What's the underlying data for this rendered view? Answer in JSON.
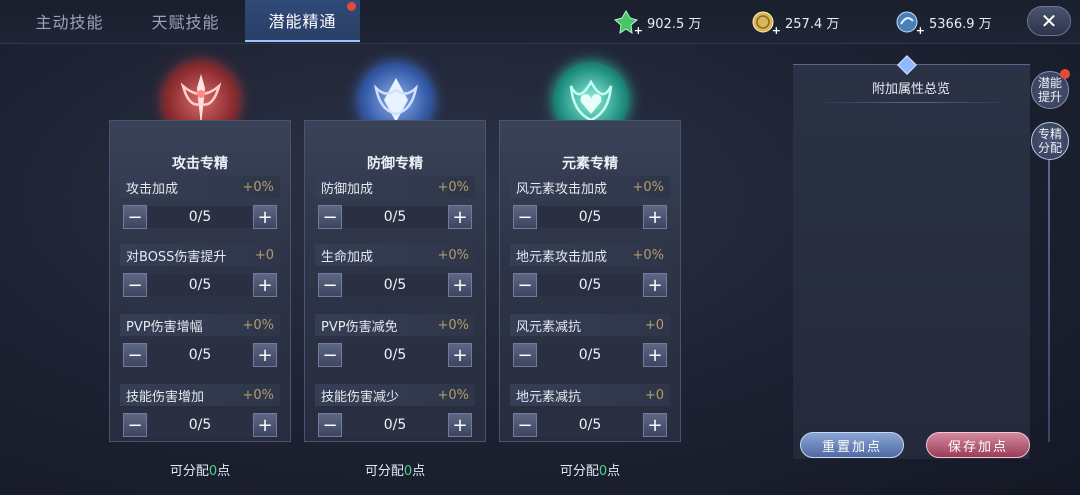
{
  "tabs": [
    {
      "label": "主动技能"
    },
    {
      "label": "天赋技能"
    },
    {
      "label": "潜能精通"
    }
  ],
  "currencies": [
    {
      "icon": "green-crystal-icon",
      "value": "902.5 万"
    },
    {
      "icon": "gold-coin-icon",
      "value": "257.4 万"
    },
    {
      "icon": "blue-gem-icon",
      "value": "5366.9 万"
    }
  ],
  "cards": [
    {
      "title": "攻击专精",
      "emblem": "attack-emblem-icon",
      "color": "#c0393b",
      "stats": [
        {
          "label": "攻击加成",
          "bonus": "+0%",
          "value": "0/5"
        },
        {
          "label": "对BOSS伤害提升",
          "bonus": "+0",
          "value": "0/5"
        },
        {
          "label": "PVP伤害增幅",
          "bonus": "+0%",
          "value": "0/5"
        },
        {
          "label": "技能伤害增加",
          "bonus": "+0%",
          "value": "0/5"
        }
      ],
      "remain_prefix": "可分配",
      "remain_value": "0",
      "remain_suffix": "点"
    },
    {
      "title": "防御专精",
      "emblem": "defense-emblem-icon",
      "color": "#3f6fc8",
      "stats": [
        {
          "label": "防御加成",
          "bonus": "+0%",
          "value": "0/5"
        },
        {
          "label": "生命加成",
          "bonus": "+0%",
          "value": "0/5"
        },
        {
          "label": "PVP伤害减免",
          "bonus": "+0%",
          "value": "0/5"
        },
        {
          "label": "技能伤害减少",
          "bonus": "+0%",
          "value": "0/5"
        }
      ],
      "remain_prefix": "可分配",
      "remain_value": "0",
      "remain_suffix": "点"
    },
    {
      "title": "元素专精",
      "emblem": "element-emblem-icon",
      "color": "#2fb5a0",
      "stats": [
        {
          "label": "风元素攻击加成",
          "bonus": "+0%",
          "value": "0/5"
        },
        {
          "label": "地元素攻击加成",
          "bonus": "+0%",
          "value": "0/5"
        },
        {
          "label": "风元素减抗",
          "bonus": "+0",
          "value": "0/5"
        },
        {
          "label": "地元素减抗",
          "bonus": "+0",
          "value": "0/5"
        }
      ],
      "remain_prefix": "可分配",
      "remain_value": "0",
      "remain_suffix": "点"
    }
  ],
  "summary": {
    "title": "附加属性总览"
  },
  "side_tabs": [
    {
      "label": "潜能提升"
    },
    {
      "label": "专精分配"
    }
  ],
  "actions": {
    "reset_label": "重置加点",
    "save_label": "保存加点"
  },
  "colors": {
    "accent_green": "#4ed38b",
    "bonus_gold": "#b39c6a",
    "badge_red": "#e24b3b"
  }
}
